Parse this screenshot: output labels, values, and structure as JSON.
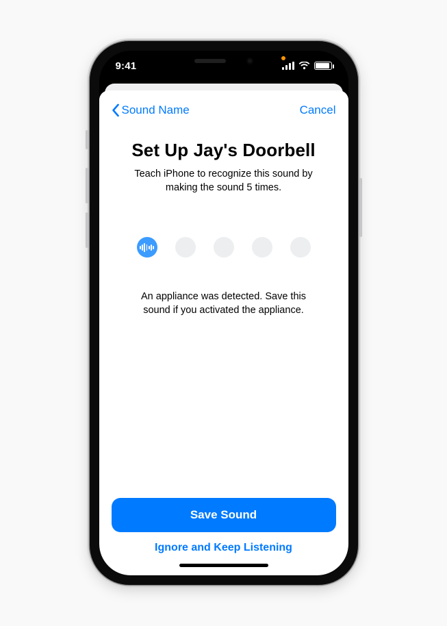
{
  "statusbar": {
    "time": "9:41"
  },
  "nav": {
    "back_label": "Sound Name",
    "cancel_label": "Cancel"
  },
  "main": {
    "title": "Set Up Jay's Doorbell",
    "subtitle": "Teach iPhone to recognize this sound by making the sound 5 times.",
    "detection_message": "An appliance was detected. Save this sound if you activated the appliance.",
    "progress": {
      "total": 5,
      "active_index": 0
    }
  },
  "actions": {
    "primary": "Save Sound",
    "secondary": "Ignore and Keep Listening"
  },
  "icons": {
    "back": "chevron-left-icon",
    "active_dot": "audio-waveform-icon",
    "recording_indicator": "recording-dot-icon",
    "signal": "cellular-signal-icon",
    "wifi": "wifi-icon",
    "battery": "battery-icon"
  },
  "colors": {
    "primary": "#007aff",
    "active_dot": "#3b9bff",
    "rec_dot": "#ff9500",
    "inactive_dot": "#eceef0"
  }
}
